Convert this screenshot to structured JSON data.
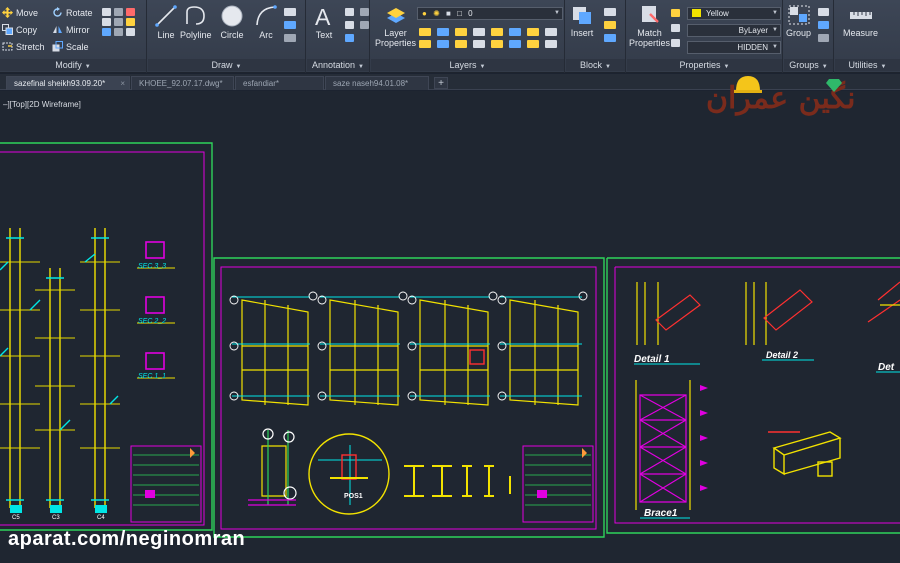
{
  "modify": {
    "title": "Modify",
    "move": "Move",
    "rotate": "Rotate",
    "copy": "Copy",
    "mirror": "Mirror",
    "stretch": "Stretch",
    "scale": "Scale"
  },
  "draw": {
    "title": "Draw",
    "line": "Line",
    "polyline": "Polyline",
    "circle": "Circle",
    "arc": "Arc"
  },
  "annotation": {
    "title": "Annotation",
    "text": "Text"
  },
  "layers": {
    "title": "Layers",
    "layer_properties_line1": "Layer",
    "layer_properties_line2": "Properties",
    "current_layer": "0"
  },
  "block": {
    "title": "Block",
    "insert": "Insert"
  },
  "properties": {
    "title": "Properties",
    "match_line1": "Match",
    "match_line2": "Properties",
    "color": "Yellow",
    "linetype": "ByLayer",
    "lineweight": "HIDDEN"
  },
  "groups": {
    "title": "Groups",
    "group": "Group"
  },
  "utilities": {
    "title": "Utilities",
    "measure": "Measure"
  },
  "tabs": [
    {
      "label": "sazefinal sheikh93.09.20*",
      "active": true
    },
    {
      "label": "KHOEE_92.07.17.dwg*",
      "active": false
    },
    {
      "label": "esfandiar*",
      "active": false
    },
    {
      "label": "saze naseh94.01.08*",
      "active": false
    }
  ],
  "tab_close_glyph": "×",
  "tab_add_glyph": "+",
  "viewport_label": "–][Top][2D Wireframe]",
  "logo_text": "نگین عمران",
  "watermark_text": "aparat.com/neginomran",
  "drawing": {
    "sec_labels": [
      "SEC 3_3",
      "SEC 2_2",
      "SEC 1_1"
    ],
    "detail_labels": [
      "Detail 1",
      "Detail 2",
      "Det"
    ],
    "brace_label": "Brace1",
    "pos_label": "POS1",
    "column_labels": [
      "C5",
      "C3",
      "C4"
    ]
  },
  "colors": {
    "accent_yellow": "#f2e200",
    "frame_green": "#2fd35a",
    "frame_magenta": "#e000e0",
    "cad_cyan": "#00e6e6",
    "cad_red": "#ff3030"
  }
}
